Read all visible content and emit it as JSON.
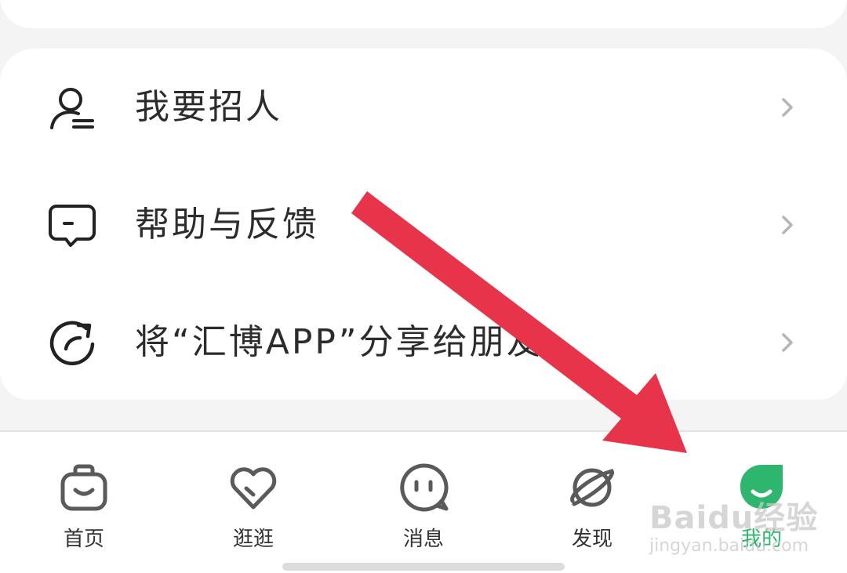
{
  "menu": {
    "items": [
      {
        "label": "我要招人",
        "icon": "recruit-person-icon"
      },
      {
        "label": "帮助与反馈",
        "icon": "feedback-message-icon"
      },
      {
        "label": "将“汇博APP”分享给朋友",
        "icon": "share-refresh-icon"
      }
    ]
  },
  "tabbar": {
    "tabs": [
      {
        "label": "首页",
        "icon": "home-bag-icon"
      },
      {
        "label": "逛逛",
        "icon": "heart-icon"
      },
      {
        "label": "消息",
        "icon": "chat-face-icon"
      },
      {
        "label": "发现",
        "icon": "planet-icon"
      },
      {
        "label": "我的",
        "icon": "profile-face-icon",
        "active": true
      }
    ]
  },
  "watermark": {
    "main": "Baidu经验",
    "sub": "jingyan.baidu.com"
  },
  "colors": {
    "accent": "#2fb66e",
    "arrow": "#e8344a",
    "text": "#2c2c2c"
  }
}
